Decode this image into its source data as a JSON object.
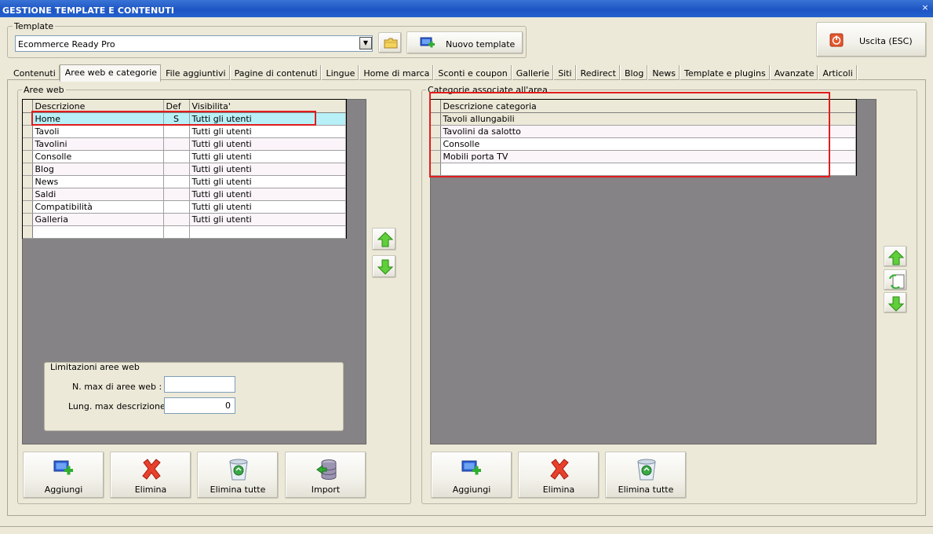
{
  "window": {
    "title": "GESTIONE TEMPLATE E CONTENUTI",
    "close_glyph": "×"
  },
  "template": {
    "group_label": "Template",
    "selected": "Ecommerce Ready Pro",
    "new_button": "Nuovo template",
    "exit_button": "Uscita (ESC)"
  },
  "tabs": [
    {
      "label": "Contenuti"
    },
    {
      "label": "Aree web e categorie"
    },
    {
      "label": "File aggiuntivi"
    },
    {
      "label": "Pagine di contenuti"
    },
    {
      "label": "Lingue"
    },
    {
      "label": "Home di marca"
    },
    {
      "label": "Sconti e coupon"
    },
    {
      "label": "Gallerie"
    },
    {
      "label": "Siti"
    },
    {
      "label": "Redirect"
    },
    {
      "label": "Blog"
    },
    {
      "label": "News"
    },
    {
      "label": "Template e plugins"
    },
    {
      "label": "Avanzate"
    },
    {
      "label": "Articoli"
    }
  ],
  "active_tab_index": 1,
  "aree": {
    "group_label": "Aree web",
    "columns": [
      "Descrizione",
      "Def",
      "Visibilita'"
    ],
    "rows": [
      [
        "Home",
        "S",
        "Tutti gli utenti"
      ],
      [
        "Tavoli",
        "",
        "Tutti gli utenti"
      ],
      [
        "Tavolini",
        "",
        "Tutti gli utenti"
      ],
      [
        "Consolle",
        "",
        "Tutti gli utenti"
      ],
      [
        "Blog",
        "",
        "Tutti gli utenti"
      ],
      [
        "News",
        "",
        "Tutti gli utenti"
      ],
      [
        "Saldi",
        "",
        "Tutti gli utenti"
      ],
      [
        "Compatibilità",
        "",
        "Tutti gli utenti"
      ],
      [
        "Galleria",
        "",
        "Tutti gli utenti"
      ]
    ],
    "limits": {
      "group_label": "Limitazioni aree web",
      "max_label": "N. max di aree web :",
      "max_value": "",
      "len_label": "Lung. max descrizione :",
      "len_value": "0"
    },
    "buttons": {
      "add": "Aggiungi",
      "delete": "Elimina",
      "delete_all": "Elimina tutte",
      "import": "Import"
    }
  },
  "categorie": {
    "group_label": "Categorie associate all'area",
    "columns": [
      "Descrizione categoria"
    ],
    "rows": [
      "Tavoli allungabili",
      "Tavolini da salotto",
      "Consolle",
      "Mobili porta TV"
    ],
    "buttons": {
      "add": "Aggiungi",
      "delete": "Elimina",
      "delete_all": "Elimina tutte"
    }
  },
  "icons": {
    "folder": "folder-icon",
    "new_template": "monitor-add-icon",
    "exit": "power-icon",
    "up": "arrow-up-icon",
    "down": "arrow-down-icon",
    "replace": "document-swap-icon",
    "add": "monitor-add-icon",
    "delete": "red-x-icon",
    "delete_all": "recycle-bin-icon",
    "import": "database-import-icon"
  },
  "colors": {
    "titlebar": "#2362cf",
    "selected_row": "#b8f0f7",
    "highlight_box": "#e01d1d",
    "grid_background": "#858385"
  }
}
